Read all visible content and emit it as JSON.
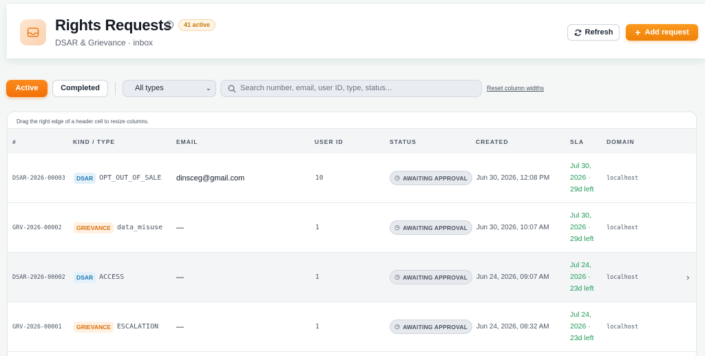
{
  "header": {
    "title": "Rights Requests",
    "active_badge": "41 active",
    "subtitle": "DSAR & Grievance · inbox",
    "refresh_label": "Refresh",
    "add_label": "Add request",
    "accent_color": "#f08208"
  },
  "toolbar": {
    "tab_active": "Active",
    "tab_completed": "Completed",
    "type_select": "All types",
    "search_placeholder": "Search number, email, user ID, type, status...",
    "reset_link": "Reset column widths"
  },
  "table": {
    "hint": "Drag the right edge of a header cell to resize columns.",
    "columns": [
      "#",
      "KIND / TYPE",
      "EMAIL",
      "USER ID",
      "STATUS",
      "CREATED",
      "SLA",
      "DOMAIN"
    ],
    "rows": [
      {
        "number": "DSAR-2026-00003",
        "kind": "DSAR",
        "type": "OPT_OUT_OF_SALE",
        "email": "dinsceg@gmail.com",
        "user_id": "10",
        "status": "AWAITING APPROVAL",
        "created": "Jun 30, 2026, 12:08 PM",
        "sla_line1": "Jul 30,",
        "sla_line2": "2026 ·",
        "sla_line3": "29d left",
        "domain": "localhost"
      },
      {
        "number": "GRV-2026-00002",
        "kind": "GRIEVANCE",
        "type": "data_misuse",
        "email": "—",
        "user_id": "1",
        "status": "AWAITING APPROVAL",
        "created": "Jun 30, 2026, 10:07 AM",
        "sla_line1": "Jul 30,",
        "sla_line2": "2026 ·",
        "sla_line3": "29d left",
        "domain": "localhost"
      },
      {
        "number": "DSAR-2026-00002",
        "kind": "DSAR",
        "type": "ACCESS",
        "email": "—",
        "user_id": "1",
        "status": "AWAITING APPROVAL",
        "created": "Jun 24, 2026, 09:07 AM",
        "sla_line1": "Jul 24,",
        "sla_line2": "2026 ·",
        "sla_line3": "23d left",
        "domain": "localhost"
      },
      {
        "number": "GRV-2026-00001",
        "kind": "GRIEVANCE",
        "type": "ESCALATION",
        "email": "—",
        "user_id": "1",
        "status": "AWAITING APPROVAL",
        "created": "Jun 24, 2026, 08:32 AM",
        "sla_line1": "Jul 24,",
        "sla_line2": "2026 ·",
        "sla_line3": "23d left",
        "domain": "localhost"
      }
    ]
  }
}
